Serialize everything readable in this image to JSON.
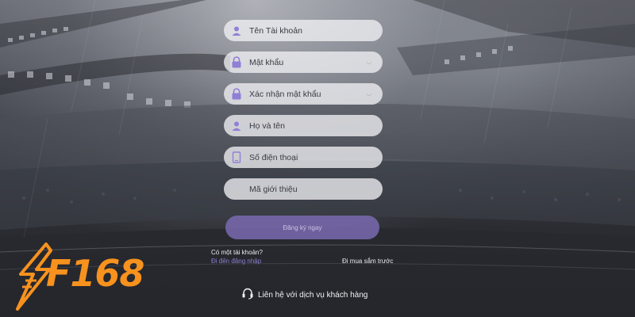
{
  "form": {
    "fields": [
      {
        "label": "Tên Tài khoản",
        "icon": "user-icon"
      },
      {
        "label": "Mật khẩu",
        "icon": "lock-icon"
      },
      {
        "label": "Xác nhận mật khẩu",
        "icon": "lock-icon"
      },
      {
        "label": "Họ và tên",
        "icon": "user-icon"
      },
      {
        "label": "Số điện thoại",
        "icon": "phone-icon"
      },
      {
        "label": "Mã giới thiệu",
        "icon": ""
      }
    ],
    "submit_label": "Đăng ký ngay"
  },
  "account": {
    "question": "Có một tài khoản?",
    "login_link": "Đi đến đăng nhập",
    "shop_link": "Đi mua sắm trước"
  },
  "support": {
    "label": "Liên hệ với dịch vụ khách hàng",
    "icon": "headset-icon"
  },
  "brand": {
    "logo_text": "F168",
    "color": "#f7921e",
    "accent": "#7a6ab0"
  }
}
